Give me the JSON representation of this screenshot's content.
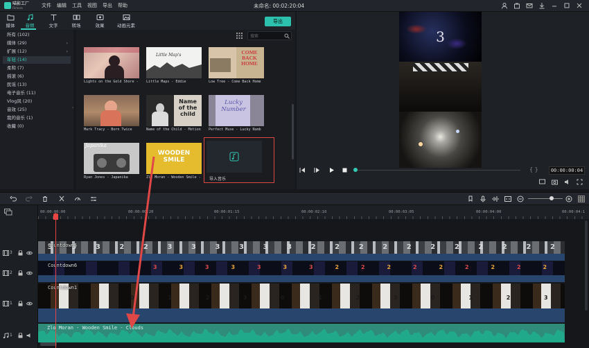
{
  "app": {
    "logo_text": "喵影工厂",
    "logo_sub": "Filmora",
    "window_title": "未命名: 00:02:20:04"
  },
  "menu": [
    "文件",
    "编辑",
    "工具",
    "视图",
    "导出",
    "帮助"
  ],
  "tabs": [
    {
      "label": "媒体",
      "icon": "folder-icon"
    },
    {
      "label": "音频",
      "icon": "music-note-icon"
    },
    {
      "label": "文字",
      "icon": "text-icon"
    },
    {
      "label": "转场",
      "icon": "transition-icon"
    },
    {
      "label": "效果",
      "icon": "effects-icon"
    },
    {
      "label": "动画元素",
      "icon": "elements-icon"
    }
  ],
  "active_tab": "音频",
  "export_label": "导出",
  "categories": [
    {
      "label": "所有 (102)"
    },
    {
      "label": "媒体 (29)",
      "expand": true
    },
    {
      "label": "扩展 (12)",
      "expand": true
    },
    {
      "label": "年轻 (14)",
      "active": true
    },
    {
      "label": "柔和 (7)"
    },
    {
      "label": "摇滚 (6)"
    },
    {
      "label": "民谣 (13)"
    },
    {
      "label": "电子音乐 (11)"
    },
    {
      "label": "Vlog风 (20)"
    },
    {
      "label": "音效 (25)"
    },
    {
      "label": "我的音乐 (1)"
    },
    {
      "label": "收藏 (0)"
    }
  ],
  "search": {
    "placeholder": "搜索"
  },
  "cards": [
    {
      "label": "Lights on the Gold Shore - ",
      "art": "pink"
    },
    {
      "label": "Little Maps - Eddie",
      "art": "maps",
      "art_text": "Little Map's"
    },
    {
      "label": "Low Tree - Come Back Home",
      "art": "home",
      "art_text": "COME BACK HOME"
    },
    {
      "label": "Mark Tracy - Born Twice",
      "art": "boy"
    },
    {
      "label": "Name of the Child - Motion",
      "art": "child",
      "art_text": "Name of the child"
    },
    {
      "label": "Perfect Muse - Lucky Numb",
      "art": "lucky",
      "art_text": "Lucky Number"
    },
    {
      "label": "Ryan Jones - Japanika",
      "art": "japanika",
      "art_text": "Japanika"
    },
    {
      "label": "Zlo Moran - Wooden Smile - ",
      "art": "wooden",
      "art_text": "WOODEN SMILE"
    }
  ],
  "import_label": "导入音乐",
  "preview": {
    "time": "00:00:00:04",
    "big_number": "3"
  },
  "ruler_ticks": [
    "00:00:00:00",
    "00:00:00:20",
    "00:00:01:15",
    "00:00:02:10",
    "00:00:03:05",
    "00:00:04:00",
    "00:00:04:1"
  ],
  "tracks": [
    {
      "num": "3",
      "label": "Countdown5",
      "digits": [
        "3",
        "3",
        "3",
        "2",
        "2",
        "3",
        "3",
        "3",
        "3",
        "3",
        "3",
        "2",
        "2",
        "2",
        "2",
        "2",
        "2",
        "2",
        "2",
        "2",
        "2",
        "2"
      ]
    },
    {
      "num": "2",
      "label": "Countdown6",
      "digits": [
        "3",
        "3",
        "3",
        "3",
        "3",
        "3",
        "3",
        "2",
        "2",
        "2",
        "2",
        "2",
        "2",
        "2",
        "2",
        "2"
      ]
    },
    {
      "num": "1",
      "label": "Countdown1",
      "digits": [
        "",
        "0",
        "1",
        "2",
        "3",
        "0",
        "1",
        "2",
        "3",
        "0",
        "1",
        "2",
        "3"
      ]
    }
  ],
  "audio": {
    "num": "1",
    "label": "Zlo Moran - Wooden Smile - Clouds"
  },
  "colors": {
    "accent": "#33c9b3",
    "highlight_border": "#e04848",
    "playhead": "#e84545",
    "audio_track": "#2f8c7a"
  }
}
